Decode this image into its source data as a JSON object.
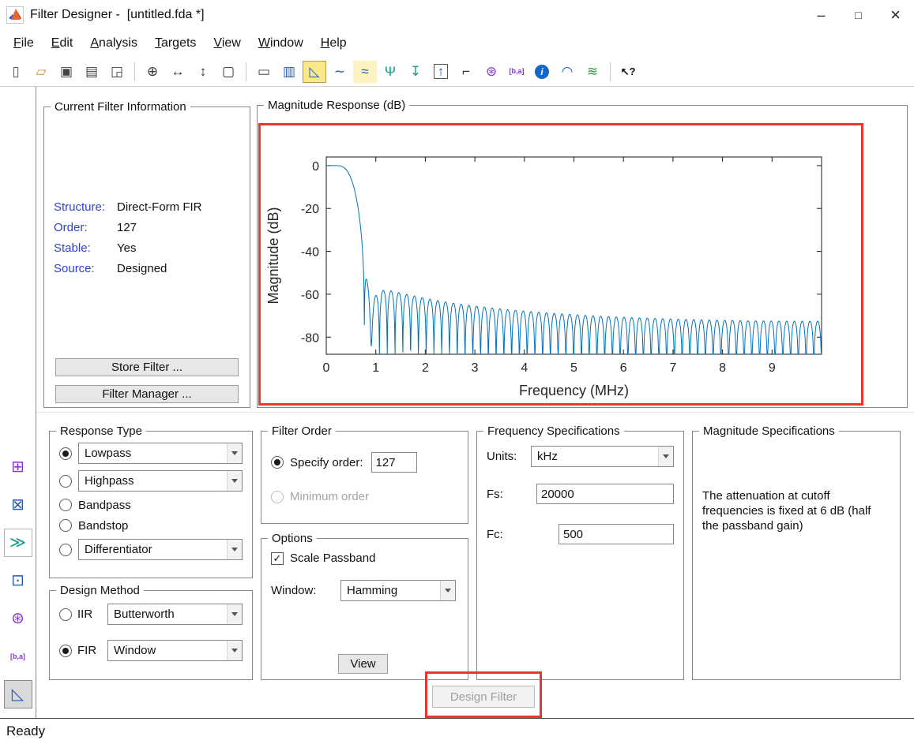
{
  "window": {
    "title": "Filter Designer -  [untitled.fda *]",
    "controls": [
      {
        "name": "minimize-button",
        "glyph": "–"
      },
      {
        "name": "maximize-button",
        "glyph": "□"
      },
      {
        "name": "close-button",
        "glyph": "×"
      }
    ]
  },
  "menu": {
    "items": [
      "File",
      "Edit",
      "Analysis",
      "Targets",
      "View",
      "Window",
      "Help"
    ]
  },
  "toolbar": {
    "icons": [
      {
        "name": "new-session-icon",
        "glyph": "▯",
        "color": "#555"
      },
      {
        "name": "open-session-icon",
        "glyph": "▱",
        "color": "#c9932f"
      },
      {
        "name": "save-session-icon",
        "glyph": "▣",
        "color": "#444"
      },
      {
        "name": "print-icon",
        "glyph": "▤",
        "color": "#444"
      },
      {
        "name": "print-preview-icon",
        "glyph": "◲",
        "color": "#444"
      },
      {
        "sep": true
      },
      {
        "name": "zoom-in-icon",
        "glyph": "⊕",
        "color": "#333"
      },
      {
        "name": "zoom-x-icon",
        "glyph": "↔",
        "color": "#333"
      },
      {
        "name": "zoom-y-icon",
        "glyph": "↕",
        "color": "#333"
      },
      {
        "name": "full-view-icon",
        "glyph": "▢",
        "color": "#333"
      },
      {
        "sep": true
      },
      {
        "name": "filter-specifications-icon",
        "glyph": "▭",
        "color": "#444"
      },
      {
        "name": "specification-mask-icon",
        "glyph": "▥",
        "color": "#2a5db0"
      },
      {
        "name": "magnitude-response-icon",
        "glyph": "◺",
        "color": "#1a5cc8",
        "active": true
      },
      {
        "name": "phase-response-icon",
        "glyph": "∼",
        "color": "#1a5cc8"
      },
      {
        "name": "magnitude-phase-response-icon",
        "glyph": "≈",
        "color": "#1a5cc8",
        "bg": "#fdf3c0"
      },
      {
        "name": "group-delay-icon",
        "glyph": "Ψ",
        "color": "#0f9b8e"
      },
      {
        "name": "phase-delay-icon",
        "glyph": "↧",
        "color": "#0f9b8e"
      },
      {
        "name": "impulse-response-icon",
        "glyph": "↑",
        "color": "#1a5cc8",
        "boxed": true
      },
      {
        "name": "step-response-icon",
        "glyph": "⌐",
        "color": "#333"
      },
      {
        "name": "pole-zero-plot-icon",
        "glyph": "⊛",
        "color": "#8237c8"
      },
      {
        "name": "filter-coefficients-icon",
        "glyph": "[b,a]",
        "color": "#8237c8",
        "small": true
      },
      {
        "name": "filter-information-icon",
        "glyph": "i",
        "round": true
      },
      {
        "name": "magnitude-response-estimate-icon",
        "glyph": "◠",
        "color": "#1a5cc8"
      },
      {
        "name": "noise-power-spectrum-icon",
        "glyph": "≋",
        "color": "#2e9e3e"
      },
      {
        "sep": true
      },
      {
        "name": "whats-this-help-icon",
        "glyph": "↖?",
        "color": "#111",
        "small2": true
      }
    ]
  },
  "side_toolbar": {
    "icons": [
      {
        "name": "set-quantization-parameters-icon",
        "glyph": "⊞",
        "color": "#8237c8"
      },
      {
        "name": "transform-filter-icon",
        "glyph": "⊠",
        "color": "#2a5db0"
      },
      {
        "name": "multirate-filter-icon",
        "glyph": "≫",
        "color": "#0f9b8e",
        "raised": true
      },
      {
        "name": "realize-model-icon",
        "glyph": "⊡",
        "color": "#2a5db0"
      },
      {
        "name": "pole-zero-editor-icon",
        "glyph": "⊛",
        "color": "#8237c8"
      },
      {
        "name": "import-filter-icon",
        "glyph": "[b,a]",
        "color": "#8237c8",
        "small": true
      },
      {
        "name": "design-filter-icon",
        "glyph": "◺",
        "color": "#1a5cc8",
        "pressed": true
      }
    ]
  },
  "filter_info": {
    "title": "Current Filter Information",
    "label_color": "#2d41cf",
    "rows": [
      {
        "label": "Structure:",
        "value": "Direct-Form FIR"
      },
      {
        "label": "Order:",
        "value": "127"
      },
      {
        "label": "Stable:",
        "value": "Yes"
      },
      {
        "label": "Source:",
        "value": "Designed"
      }
    ],
    "store_button": "Store Filter ...",
    "manager_button": "Filter Manager ..."
  },
  "magnitude_response": {
    "title": "Magnitude Response (dB)"
  },
  "chart_data": {
    "type": "line",
    "title": "Magnitude Response (dB)",
    "xlabel": "Frequency (MHz)",
    "ylabel": "Magnitude (dB)",
    "xlim": [
      0,
      10
    ],
    "ylim": [
      -88,
      4
    ],
    "xticks": [
      0,
      1,
      2,
      3,
      4,
      5,
      6,
      7,
      8,
      9
    ],
    "yticks": [
      0,
      -20,
      -40,
      -60,
      -80
    ],
    "grid": false,
    "legend": false,
    "line_color": "#0072bd",
    "filter": {
      "response": "lowpass",
      "structure": "Direct-Form FIR",
      "design_method": "window",
      "window": "Hamming",
      "order": 127,
      "fs_khz": 20000,
      "fc_khz": 500,
      "passband_gain_db": 0,
      "gain_at_cutoff_db": -6,
      "stopband_sidelobes_db": "peaks ≈ -55 dB near 1 MHz decaying to ≈ -75 dB near 10 MHz, nulls clipped below -88 dB"
    }
  },
  "response_type": {
    "title": "Response Type",
    "options": [
      {
        "label": "Lowpass",
        "selected": true,
        "dropdown": true
      },
      {
        "label": "Highpass",
        "selected": false,
        "dropdown": true
      },
      {
        "label": "Bandpass",
        "selected": false,
        "dropdown": false
      },
      {
        "label": "Bandstop",
        "selected": false,
        "dropdown": false
      },
      {
        "label": "Differentiator",
        "selected": false,
        "dropdown": true
      }
    ]
  },
  "design_method": {
    "title": "Design Method",
    "iir": {
      "label": "IIR",
      "value": "Butterworth",
      "selected": false
    },
    "fir": {
      "label": "FIR",
      "value": "Window",
      "selected": true
    }
  },
  "filter_order": {
    "title": "Filter Order",
    "specify_label": "Specify order:",
    "specify_value": "127",
    "specify_selected": true,
    "minimum_label": "Minimum order",
    "minimum_enabled": false
  },
  "options": {
    "title": "Options",
    "scale_passband_label": "Scale Passband",
    "scale_passband_checked": true,
    "window_label": "Window:",
    "window_value": "Hamming",
    "view_button": "View"
  },
  "frequency_specs": {
    "title": "Frequency Specifications",
    "units_label": "Units:",
    "units_value": "kHz",
    "fs_label": "Fs:",
    "fs_value": "20000",
    "fc_label": "Fc:",
    "fc_value": "500"
  },
  "magnitude_specs": {
    "title": "Magnitude Specifications",
    "text": "The attenuation at cutoff frequencies is fixed at 6 dB (half the passband gain)"
  },
  "design": {
    "button_label": "Design Filter",
    "enabled": false
  },
  "annotations": {
    "color": "#e8372c",
    "highlighted": [
      "magnitude-response-plot",
      "design-filter-button"
    ]
  },
  "status": {
    "text": "Ready"
  }
}
